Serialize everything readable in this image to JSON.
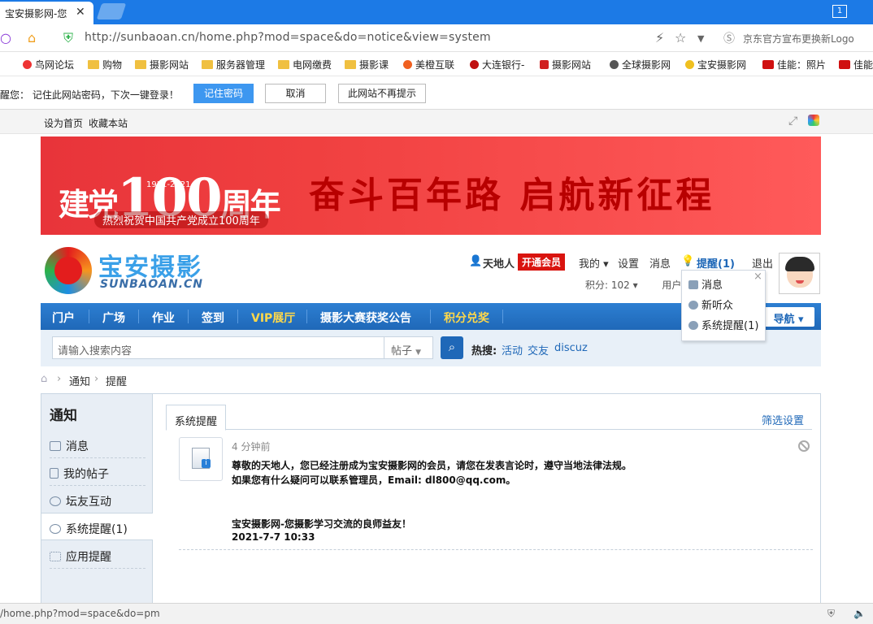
{
  "browser": {
    "tab_title": "宝安摄影网-您",
    "tab_close": "✕",
    "tab_count": "1",
    "url": "http://sunbaoan.cn/home.php?mod=space&do=notice&view=system",
    "address_right": "京东官方宣布更换新Logo"
  },
  "bookmarks": [
    "鸟网论坛",
    "购物",
    "摄影网站",
    "服务器管理",
    "电网缴费",
    "摄影课",
    "美橙互联",
    "大连银行-",
    "摄影网站",
    "全球摄影网",
    "宝安摄影网",
    "佳能：照片",
    "佳能"
  ],
  "password_bar": {
    "text": "醒您：   记住此网站密码，下次一键登录！",
    "remember": "记住密码",
    "cancel": "取消",
    "never": "此网站不再提示"
  },
  "topbar": {
    "set_home": "设为首页",
    "favorite": "收藏本站"
  },
  "banner": {
    "left_text": "建党",
    "hundred": "100",
    "right_text": "周年",
    "years": "1921-2021",
    "slogan": "奋斗百年路 启航新征程",
    "sub": "热烈祝贺中国共产党成立100周年"
  },
  "logo": {
    "cn": "宝安摄影",
    "en": "SUNBAOAN.CN"
  },
  "user": {
    "name": "天地人",
    "vip": "开通会员",
    "mine": "我的",
    "settings": "设置",
    "messages": "消息",
    "reminder": "提醒(1)",
    "logout": "退出",
    "points": "积分: 102",
    "user_group": "用户"
  },
  "dropdown": {
    "items": [
      "消息",
      "新听众",
      "系统提醒(1)"
    ],
    "close": "×"
  },
  "nav": {
    "items": [
      "门户",
      "广场",
      "作业",
      "签到",
      "VIP展厅",
      "摄影大赛获奖公告",
      "积分兑奖"
    ],
    "guide": "导航"
  },
  "search": {
    "placeholder": "请输入搜索内容",
    "type": "帖子",
    "hot_label": "热搜:",
    "hot": [
      "活动",
      "交友",
      "discuz"
    ]
  },
  "breadcrumb": [
    "通知",
    "提醒"
  ],
  "sidebar": {
    "title": "通知",
    "items": [
      "消息",
      "我的帖子",
      "坛友互动",
      "系统提醒(1)",
      "应用提醒"
    ]
  },
  "content": {
    "tab": "系统提醒",
    "filter": "筛选设置",
    "time": "4 分钟前",
    "line1": "尊敬的天地人，您已经注册成为宝安摄影网的会员，请您在发表言论时，遵守当地法律法规。",
    "line2": "如果您有什么疑问可以联系管理员，Email: dl800@qq.com。",
    "line3": "宝安摄影网-您摄影学习交流的良师益友！",
    "line4": "2021-7-7 10:33"
  },
  "statusbar": {
    "url": "/home.php?mod=space&do=pm"
  },
  "colors": {
    "nav_blue": "#1f68b8",
    "vip_red": "#d9140f",
    "banner_red": "#e8343a"
  }
}
